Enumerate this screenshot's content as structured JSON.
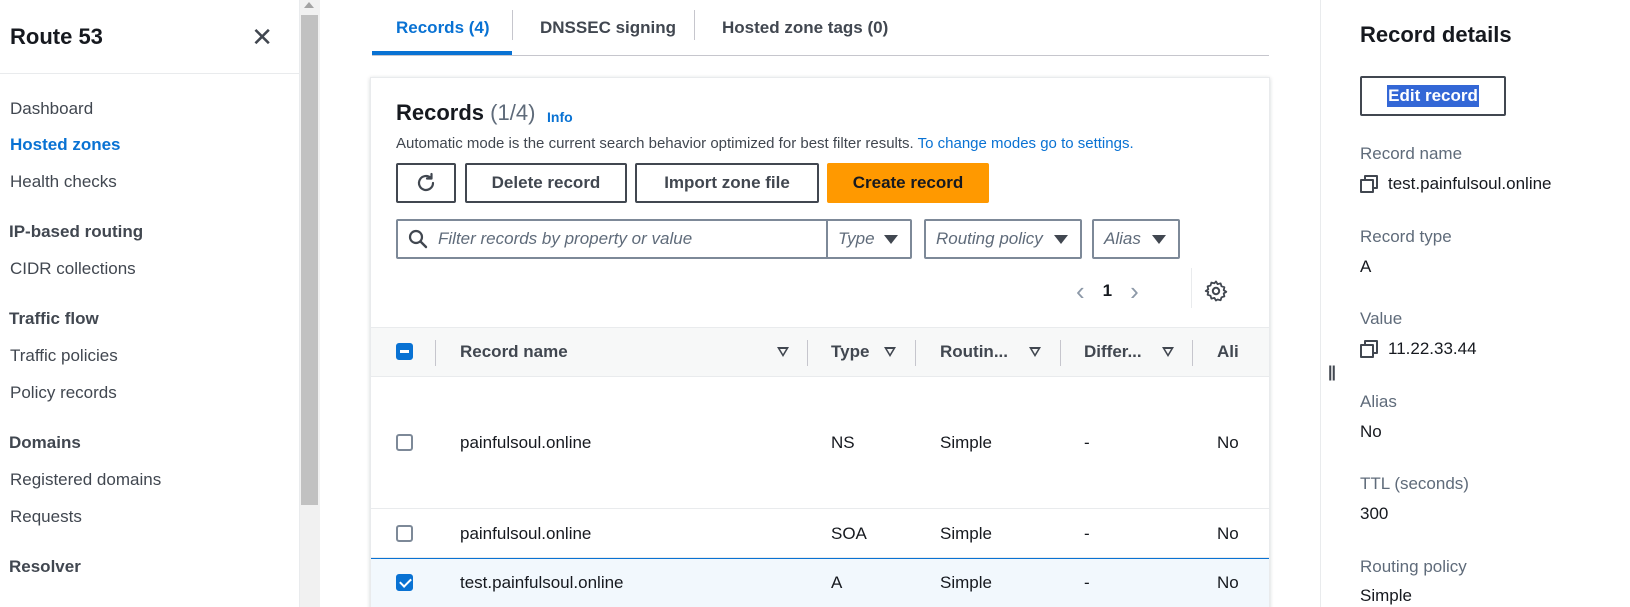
{
  "nav": {
    "title": "Route 53",
    "items": [
      {
        "label": "Dashboard"
      },
      {
        "label": "Hosted zones",
        "active": true
      },
      {
        "label": "Health checks"
      }
    ],
    "sections": [
      {
        "title": "IP-based routing",
        "items": [
          {
            "label": "CIDR collections"
          }
        ]
      },
      {
        "title": "Traffic flow",
        "items": [
          {
            "label": "Traffic policies"
          },
          {
            "label": "Policy records"
          }
        ]
      },
      {
        "title": "Domains",
        "items": [
          {
            "label": "Registered domains"
          },
          {
            "label": "Requests"
          }
        ]
      },
      {
        "title": "Resolver",
        "items": []
      }
    ]
  },
  "tabs": [
    {
      "label": "Records (4)",
      "active": true
    },
    {
      "label": "DNSSEC signing"
    },
    {
      "label": "Hosted zone tags (0)"
    }
  ],
  "records": {
    "title": "Records",
    "count": "(1/4)",
    "info": "Info",
    "description": "Automatic mode is the current search behavior optimized for best filter results.",
    "description_link": "To change modes go to settings.",
    "buttons": {
      "delete": "Delete record",
      "import": "Import zone file",
      "create": "Create record"
    },
    "filter_placeholder": "Filter records by property or value",
    "filters": {
      "type": "Type",
      "routing": "Routing policy",
      "alias": "Alias"
    },
    "page": "1",
    "columns": [
      "Record name",
      "Type",
      "Routin...",
      "Differ...",
      "Ali"
    ],
    "rows": [
      {
        "name": "painfulsoul.online",
        "type": "NS",
        "routing": "Simple",
        "differ": "-",
        "alias": "No",
        "selected": false
      },
      {
        "name": "painfulsoul.online",
        "type": "SOA",
        "routing": "Simple",
        "differ": "-",
        "alias": "No",
        "selected": false
      },
      {
        "name": "test.painfulsoul.online",
        "type": "A",
        "routing": "Simple",
        "differ": "-",
        "alias": "No",
        "selected": true
      }
    ]
  },
  "details": {
    "title": "Record details",
    "edit_button": "Edit record",
    "fields": {
      "name_label": "Record name",
      "name_value": "test.painfulsoul.online",
      "type_label": "Record type",
      "type_value": "A",
      "value_label": "Value",
      "value_value": "11.22.33.44",
      "alias_label": "Alias",
      "alias_value": "No",
      "ttl_label": "TTL (seconds)",
      "ttl_value": "300",
      "routing_label": "Routing policy",
      "routing_value": "Simple"
    }
  },
  "colors": {
    "link": "#0972d3",
    "primary_button": "#ff9900",
    "text": "#16191f",
    "muted": "#5f6b7a"
  },
  "icons": [
    "close-icon",
    "refresh-icon",
    "search-icon",
    "caret-down-icon",
    "chevron-left-icon",
    "chevron-right-icon",
    "settings-gear-icon",
    "sort-icon",
    "copy-icon",
    "resize-handle-icon"
  ]
}
